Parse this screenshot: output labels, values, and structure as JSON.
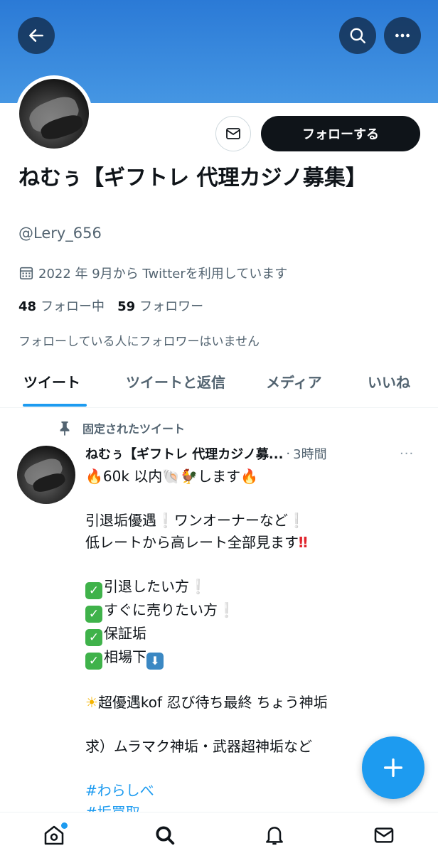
{
  "header": {
    "back_icon": "arrow-left-icon",
    "search_icon": "search-icon",
    "more_icon": "more-horizontal-icon",
    "banner_color": "#3b8ade"
  },
  "profile": {
    "display_name": "ねむぅ【ギフトレ 代理カジノ募集】",
    "handle": "@Lery_656",
    "joined": "2022 年 9月から Twitterを利用しています",
    "following_count": "48",
    "following_label": "フォロー中",
    "followers_count": "59",
    "followers_label": "フォロワー",
    "followers_you_know": "フォローしている人にフォロワーはいません",
    "follow_button": "フォローする",
    "message_icon": "envelope-icon"
  },
  "tabs": [
    {
      "label": "ツイート",
      "active": true
    },
    {
      "label": "ツイートと返信",
      "active": false
    },
    {
      "label": "メディア",
      "active": false
    },
    {
      "label": "いいね",
      "active": false
    }
  ],
  "tweet": {
    "pinned_label": "固定されたツイート",
    "author_name": "ねむぅ【ギフトレ 代理カジノ募...",
    "separator": "·",
    "time": "3時間",
    "more": "···",
    "lines": {
      "l1": "60k 以内",
      "l1b": "します",
      "l2": "引退垢優遇",
      "l2b": "ワンオーナーなど",
      "l3": "低レートから高レート全部見ます",
      "l4": "引退したい方",
      "l5": "すぐに売りたい方",
      "l6": "保証垢",
      "l7": "相場下",
      "l8": "超優遇kof 忍び待ち最終 ちょう神垢",
      "l9": "求）ムラマク神垢・武器超神垢など",
      "tag1": "#わらしべ",
      "tag2": "#垢買取"
    }
  },
  "fab": {
    "icon": "plus-icon",
    "color": "#1d9bf0"
  },
  "bottom_nav": [
    "home-icon",
    "search-icon",
    "bell-icon",
    "mail-icon"
  ],
  "accent": "#1d9bf0"
}
